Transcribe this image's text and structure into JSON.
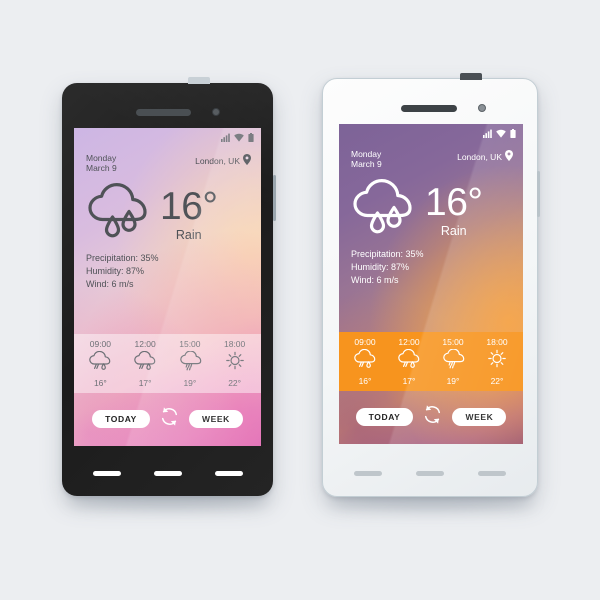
{
  "scene": {
    "background_color": "#eceef1",
    "title": "Weather app UI on two smartphones"
  },
  "phones": [
    {
      "id": "phone-dark",
      "variant": "black",
      "body_color": "#1c1c1c",
      "nav_key_color": "#ffffff",
      "accent_color": "#e07fc0",
      "hourly_bar_color": "rgba(255,255,255,0.46)",
      "text_color": "#4f5257",
      "status_bar": {
        "signal_icon": "signal-bars-icon",
        "wifi_icon": "wifi-icon",
        "battery_icon": "battery-icon"
      },
      "header": {
        "day": "Monday",
        "date": "March 9",
        "location": "London, UK",
        "location_icon": "map-pin-icon"
      },
      "current": {
        "condition_icon": "cloud-rain-icon",
        "temperature": "16°",
        "condition": "Rain"
      },
      "details": [
        "Precipitation: 35%",
        "Humidity: 87%",
        "Wind: 6 m/s"
      ],
      "hourly": [
        {
          "time": "09:00",
          "icon": "cloud-rain-icon",
          "temp": "16°"
        },
        {
          "time": "12:00",
          "icon": "cloud-rain-icon",
          "temp": "17°"
        },
        {
          "time": "15:00",
          "icon": "cloud-drizzle-icon",
          "temp": "19°"
        },
        {
          "time": "18:00",
          "icon": "sun-icon",
          "temp": "22°"
        }
      ],
      "actions": {
        "today_label": "TODAY",
        "refresh_icon": "refresh-icon",
        "week_label": "WEEK"
      }
    },
    {
      "id": "phone-light",
      "variant": "white",
      "body_color": "#f6f8f9",
      "nav_key_color": "#bfc6cb",
      "accent_color": "#f7941e",
      "hourly_bar_color": "#f7941e",
      "text_color": "#ffffff",
      "status_bar": {
        "signal_icon": "signal-bars-icon",
        "wifi_icon": "wifi-icon",
        "battery_icon": "battery-icon"
      },
      "header": {
        "day": "Monday",
        "date": "March 9",
        "location": "London, UK",
        "location_icon": "map-pin-icon"
      },
      "current": {
        "condition_icon": "cloud-rain-icon",
        "temperature": "16°",
        "condition": "Rain"
      },
      "details": [
        "Precipitation: 35%",
        "Humidity: 87%",
        "Wind: 6 m/s"
      ],
      "hourly": [
        {
          "time": "09:00",
          "icon": "cloud-rain-icon",
          "temp": "16°"
        },
        {
          "time": "12:00",
          "icon": "cloud-rain-icon",
          "temp": "17°"
        },
        {
          "time": "15:00",
          "icon": "cloud-drizzle-icon",
          "temp": "19°"
        },
        {
          "time": "18:00",
          "icon": "sun-icon",
          "temp": "22°"
        }
      ],
      "actions": {
        "today_label": "TODAY",
        "refresh_icon": "refresh-icon",
        "week_label": "WEEK"
      }
    }
  ]
}
